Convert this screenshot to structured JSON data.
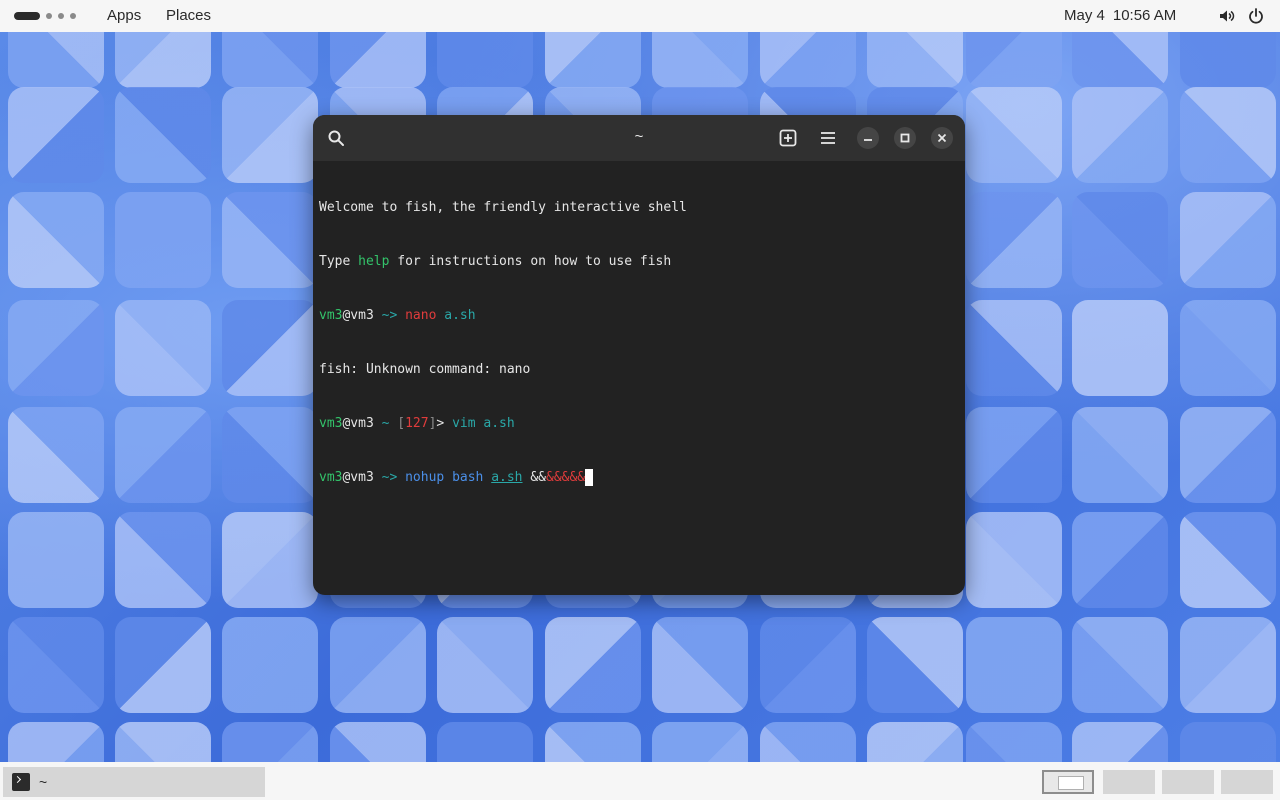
{
  "topbar": {
    "apps_label": "Apps",
    "places_label": "Places",
    "date": "May 4",
    "time": "10:56 AM",
    "icons": [
      "volume-icon",
      "power-icon"
    ]
  },
  "terminal_window": {
    "title": "~",
    "header_icons": [
      "search-icon",
      "new-tab-icon",
      "menu-icon",
      "minimize-icon",
      "maximize-icon",
      "close-icon"
    ],
    "lines": {
      "l1": "Welcome to fish, the friendly interactive shell",
      "l2_a": "Type ",
      "l2_help": "help",
      "l2_b": " for instructions on how to use fish",
      "l3_user": "vm3",
      "l3_host": "@vm3",
      "l3_prompt": " ~> ",
      "l3_cmd": "nano",
      "l3_arg": " a.sh",
      "l4": "fish: Unknown command: nano",
      "l5_user": "vm3",
      "l5_host": "@vm3",
      "l5_tilde": " ~ ",
      "l5_status_open": "[",
      "l5_status": "127",
      "l5_status_close": "]",
      "l5_arrow": "> ",
      "l5_cmd": "vim a.sh",
      "l6_user": "vm3",
      "l6_host": "@vm3",
      "l6_prompt": " ~> ",
      "l6_cmd": "nohup bash ",
      "l6_file": "a.sh",
      "l6_space": " ",
      "l6_amp": "&&",
      "l6_err": "&&&&&"
    }
  },
  "taskbar": {
    "task_label": "~",
    "workspaces": 4,
    "active_workspace": 1
  },
  "colors": {
    "terminal_bg": "#222222",
    "headerbar_bg": "#303030",
    "prompt_user": "#33c36a",
    "cwd": "#2aa8a8",
    "error": "#e03c3c",
    "command": "#4b8fe8"
  }
}
